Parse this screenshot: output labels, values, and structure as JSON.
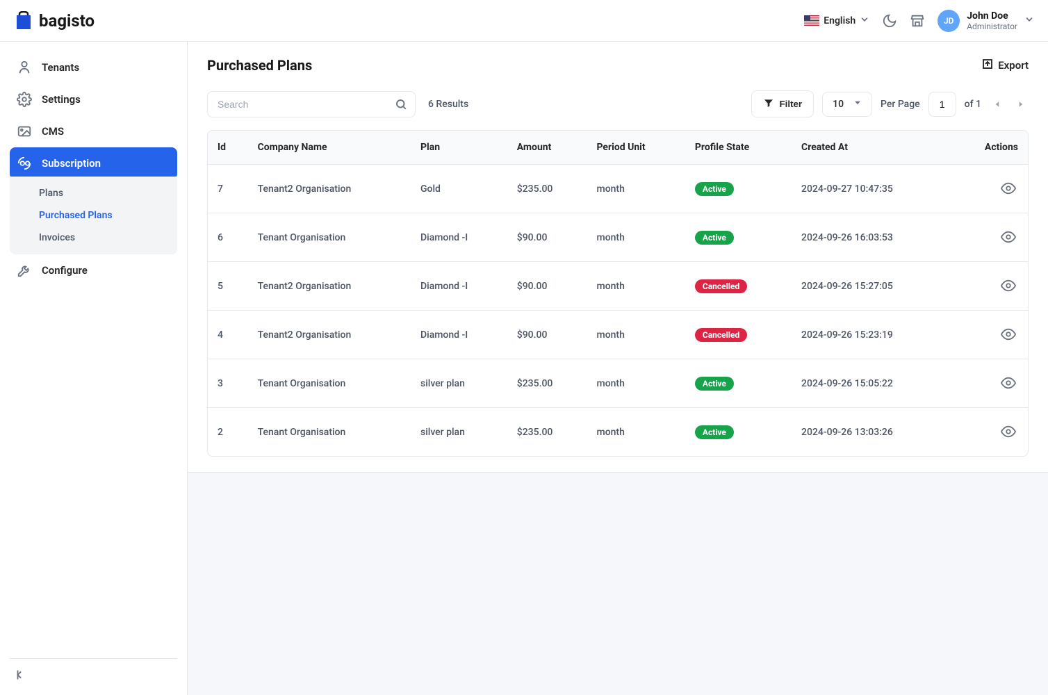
{
  "header": {
    "brand": "bagisto",
    "language": "English",
    "user": {
      "initials": "JD",
      "name": "John Doe",
      "role": "Administrator"
    }
  },
  "sidebar": {
    "items": [
      {
        "key": "tenants",
        "label": "Tenants"
      },
      {
        "key": "settings",
        "label": "Settings"
      },
      {
        "key": "cms",
        "label": "CMS"
      },
      {
        "key": "subscription",
        "label": "Subscription"
      },
      {
        "key": "configure",
        "label": "Configure"
      }
    ],
    "submenu": [
      {
        "key": "plans",
        "label": "Plans"
      },
      {
        "key": "purchased-plans",
        "label": "Purchased Plans"
      },
      {
        "key": "invoices",
        "label": "Invoices"
      }
    ]
  },
  "page": {
    "title": "Purchased Plans",
    "export_label": "Export",
    "search_placeholder": "Search",
    "results_text": "6 Results",
    "filter_label": "Filter",
    "perpage_value": "10",
    "perpage_label": "Per Page",
    "page_input": "1",
    "of_text": "of 1"
  },
  "table": {
    "headers": {
      "id": "Id",
      "company": "Company Name",
      "plan": "Plan",
      "amount": "Amount",
      "period": "Period Unit",
      "state": "Profile State",
      "created": "Created At",
      "actions": "Actions"
    },
    "rows": [
      {
        "id": "7",
        "company": "Tenant2 Organisation",
        "plan": "Gold",
        "amount": "$235.00",
        "period": "month",
        "state": "Active",
        "state_class": "active",
        "created": "2024-09-27 10:47:35"
      },
      {
        "id": "6",
        "company": "Tenant Organisation",
        "plan": "Diamond -I",
        "amount": "$90.00",
        "period": "month",
        "state": "Active",
        "state_class": "active",
        "created": "2024-09-26 16:03:53"
      },
      {
        "id": "5",
        "company": "Tenant2 Organisation",
        "plan": "Diamond -I",
        "amount": "$90.00",
        "period": "month",
        "state": "Cancelled",
        "state_class": "cancelled",
        "created": "2024-09-26 15:27:05"
      },
      {
        "id": "4",
        "company": "Tenant2 Organisation",
        "plan": "Diamond -I",
        "amount": "$90.00",
        "period": "month",
        "state": "Cancelled",
        "state_class": "cancelled",
        "created": "2024-09-26 15:23:19"
      },
      {
        "id": "3",
        "company": "Tenant Organisation",
        "plan": "silver plan",
        "amount": "$235.00",
        "period": "month",
        "state": "Active",
        "state_class": "active",
        "created": "2024-09-26 15:05:22"
      },
      {
        "id": "2",
        "company": "Tenant Organisation",
        "plan": "silver plan",
        "amount": "$235.00",
        "period": "month",
        "state": "Active",
        "state_class": "active",
        "created": "2024-09-26 13:03:26"
      }
    ]
  }
}
